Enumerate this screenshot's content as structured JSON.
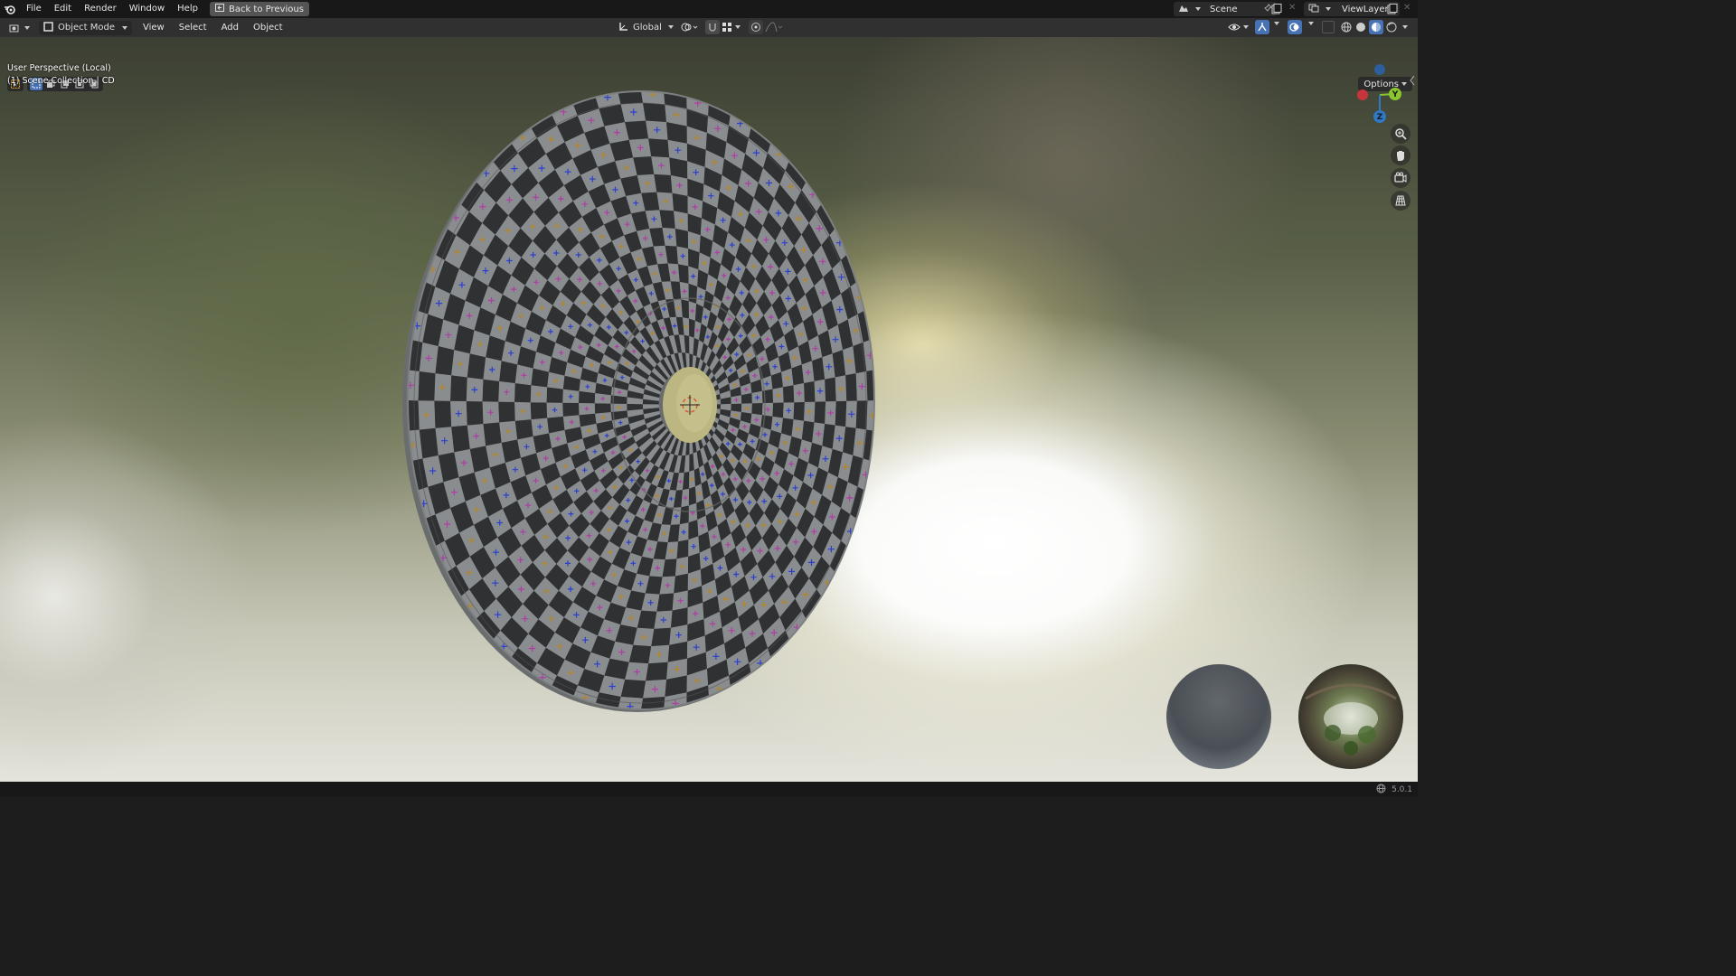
{
  "topbar": {
    "menus": [
      "File",
      "Edit",
      "Render",
      "Window",
      "Help"
    ],
    "back_button": "Back to Previous",
    "scene": "Scene",
    "view_layer": "ViewLayer"
  },
  "header": {
    "mode": "Object Mode",
    "menus": [
      "View",
      "Select",
      "Add",
      "Object"
    ],
    "orientation": "Global",
    "options": "Options"
  },
  "viewport": {
    "perspective_label": "User Perspective (Local)",
    "collection_label": "(1) Scene Collection | CD",
    "gizmo": {
      "y_label": "Y",
      "z_label": "Z"
    }
  },
  "status": {
    "version": "5.0.1"
  },
  "colors": {
    "accent": "#4772b3",
    "topbar": "#181818",
    "header": "#303030",
    "x_axis": "#c8343c",
    "y_axis": "#8bc530",
    "z_axis": "#2f78c6"
  }
}
